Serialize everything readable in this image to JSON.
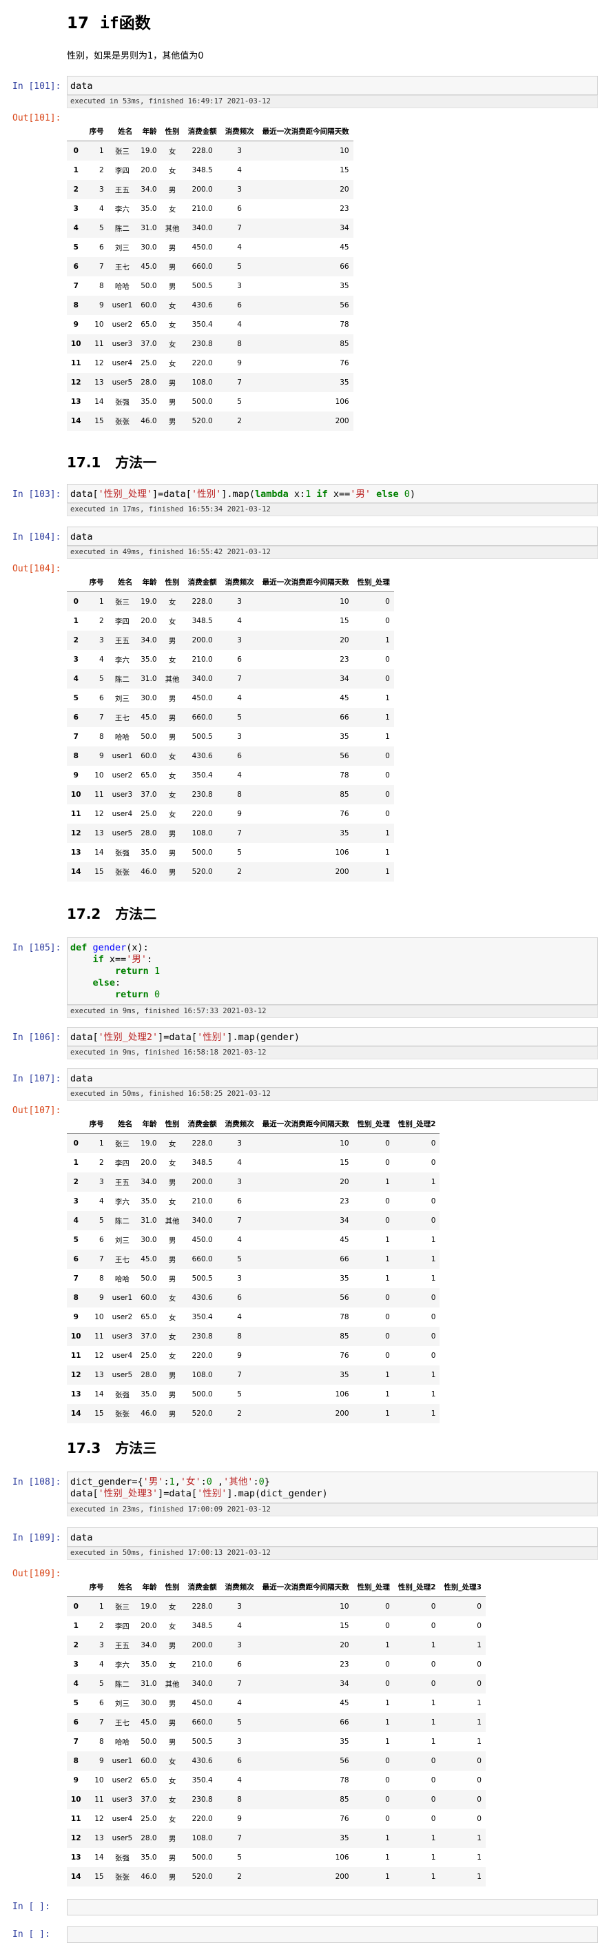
{
  "headings": {
    "h17": {
      "num": "17",
      "title": "if函数"
    },
    "h17_1": {
      "num": "17.1",
      "title": "方法一"
    },
    "h17_2": {
      "num": "17.2",
      "title": "方法二"
    },
    "h17_3": {
      "num": "17.3",
      "title": "方法三"
    }
  },
  "desc": "性别，如果是男则为1，其他值为0",
  "prompts": {
    "in101": "In [101]:",
    "out101": "Out[101]:",
    "in103": "In [103]:",
    "in104": "In [104]:",
    "out104": "Out[104]:",
    "in105": "In [105]:",
    "in106": "In [106]:",
    "in107": "In [107]:",
    "out107": "Out[107]:",
    "in108": "In [108]:",
    "in109": "In [109]:",
    "out109": "Out[109]:",
    "in_empty1": "In [ ]:",
    "in_empty2": "In [ ]:"
  },
  "code": {
    "c101": "data",
    "c103": {
      "p1": "data[",
      "s1": "'性别_处理'",
      "p2": "]=data[",
      "s2": "'性别'",
      "p3": "].map(",
      "k1": "lambda",
      "p4": " x:",
      "n1": "1",
      "k2": " if ",
      "p5": "x==",
      "s3": "'男'",
      "k3": " else ",
      "n2": "0",
      "p6": ")"
    },
    "c104": "data",
    "c105": {
      "l1_def": "def ",
      "l1_fn": "gender",
      "l1_rest": "(x):",
      "l2_if": "if",
      "l2_mid": " x==",
      "l2_str": "'男'",
      "l2_end": ":",
      "l3_ret": "return",
      "l3_num": " 1",
      "l4_else": "else",
      "l4_end": ":",
      "l5_ret": "return",
      "l5_num": " 0"
    },
    "c106": {
      "p1": "data[",
      "s1": "'性别_处理2'",
      "p2": "]=data[",
      "s2": "'性别'",
      "p3": "].map(gender)"
    },
    "c107": "data",
    "c108": {
      "l1_a": "dict_gender={",
      "l1_s1": "'男'",
      "l1_b": ":",
      "l1_n1": "1",
      "l1_c": ",",
      "l1_s2": "'女'",
      "l1_d": ":",
      "l1_n2": "0",
      "l1_e": " ,",
      "l1_s3": "'其他'",
      "l1_f": ":",
      "l1_n3": "0",
      "l1_g": "}",
      "l2_a": "data[",
      "l2_s1": "'性别_处理3'",
      "l2_b": "]=data[",
      "l2_s2": "'性别'",
      "l2_c": "].map(dict_gender)"
    },
    "c109": "data"
  },
  "exec": {
    "e101": "executed in 53ms, finished 16:49:17 2021-03-12",
    "e103": "executed in 17ms, finished 16:55:34 2021-03-12",
    "e104": "executed in 49ms, finished 16:55:42 2021-03-12",
    "e105": "executed in 9ms, finished 16:57:33 2021-03-12",
    "e106": "executed in 9ms, finished 16:58:18 2021-03-12",
    "e107": "executed in 50ms, finished 16:58:25 2021-03-12",
    "e108": "executed in 23ms, finished 17:00:09 2021-03-12",
    "e109": "executed in 50ms, finished 17:00:13 2021-03-12"
  },
  "table": {
    "columns": [
      "序号",
      "姓名",
      "年龄",
      "性别",
      "消费金额",
      "消费频次",
      "最近一次消费距今间隔天数",
      "性别_处理",
      "性别_处理2",
      "性别_处理3"
    ],
    "rows": [
      [
        "1",
        "张三",
        "19.0",
        "女",
        "228.0",
        "3",
        "10",
        "0",
        "0",
        "0"
      ],
      [
        "2",
        "李四",
        "20.0",
        "女",
        "348.5",
        "4",
        "15",
        "0",
        "0",
        "0"
      ],
      [
        "3",
        "王五",
        "34.0",
        "男",
        "200.0",
        "3",
        "20",
        "1",
        "1",
        "1"
      ],
      [
        "4",
        "李六",
        "35.0",
        "女",
        "210.0",
        "6",
        "23",
        "0",
        "0",
        "0"
      ],
      [
        "5",
        "陈二",
        "31.0",
        "其他",
        "340.0",
        "7",
        "34",
        "0",
        "0",
        "0"
      ],
      [
        "6",
        "刘三",
        "30.0",
        "男",
        "450.0",
        "4",
        "45",
        "1",
        "1",
        "1"
      ],
      [
        "7",
        "王七",
        "45.0",
        "男",
        "660.0",
        "5",
        "66",
        "1",
        "1",
        "1"
      ],
      [
        "8",
        "哈哈",
        "50.0",
        "男",
        "500.5",
        "3",
        "35",
        "1",
        "1",
        "1"
      ],
      [
        "9",
        "user1",
        "60.0",
        "女",
        "430.6",
        "6",
        "56",
        "0",
        "0",
        "0"
      ],
      [
        "10",
        "user2",
        "65.0",
        "女",
        "350.4",
        "4",
        "78",
        "0",
        "0",
        "0"
      ],
      [
        "11",
        "user3",
        "37.0",
        "女",
        "230.8",
        "8",
        "85",
        "0",
        "0",
        "0"
      ],
      [
        "12",
        "user4",
        "25.0",
        "女",
        "220.0",
        "9",
        "76",
        "0",
        "0",
        "0"
      ],
      [
        "13",
        "user5",
        "28.0",
        "男",
        "108.0",
        "7",
        "35",
        "1",
        "1",
        "1"
      ],
      [
        "14",
        "张强",
        "35.0",
        "男",
        "500.0",
        "5",
        "106",
        "1",
        "1",
        "1"
      ],
      [
        "15",
        "张张",
        "46.0",
        "男",
        "520.0",
        "2",
        "200",
        "1",
        "1",
        "1"
      ]
    ]
  }
}
